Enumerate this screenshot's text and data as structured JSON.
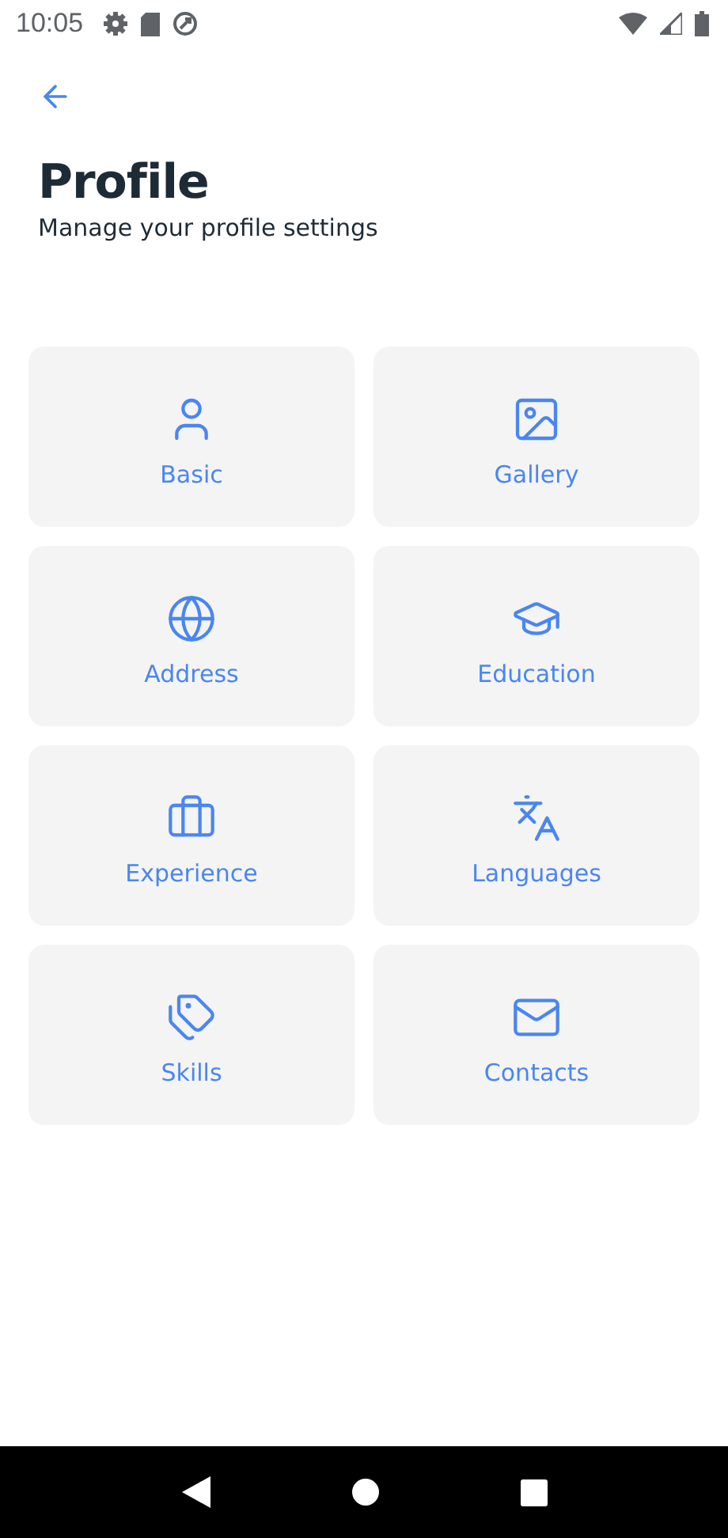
{
  "status_bar": {
    "time": "10:05"
  },
  "header": {
    "title": "Profile",
    "subtitle": "Manage your profile settings"
  },
  "cards": [
    {
      "label": "Basic",
      "kind": "person"
    },
    {
      "label": "Gallery",
      "kind": "image"
    },
    {
      "label": "Address",
      "kind": "globe"
    },
    {
      "label": "Education",
      "kind": "cap"
    },
    {
      "label": "Experience",
      "kind": "briefcase"
    },
    {
      "label": "Languages",
      "kind": "translate"
    },
    {
      "label": "Skills",
      "kind": "tags"
    },
    {
      "label": "Contacts",
      "kind": "mail"
    }
  ]
}
